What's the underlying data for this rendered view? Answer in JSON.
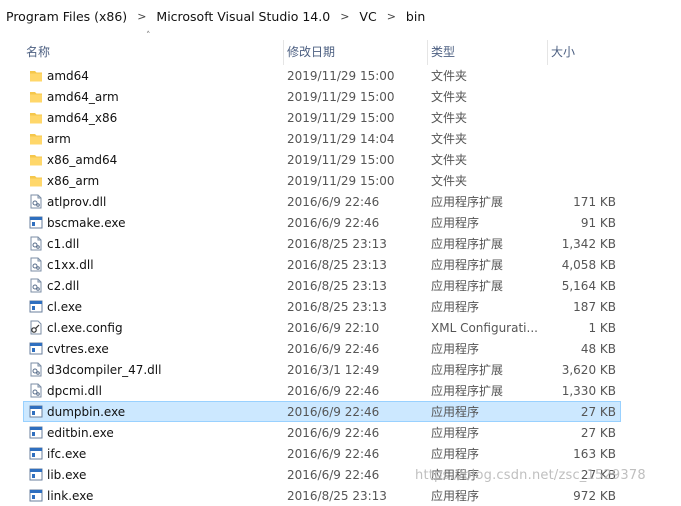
{
  "breadcrumb": [
    "Program Files (x86)",
    "Microsoft Visual Studio 14.0",
    "VC",
    "bin"
  ],
  "columns": {
    "name": "名称",
    "date": "修改日期",
    "type": "类型",
    "size": "大小"
  },
  "files": [
    {
      "name": "amd64",
      "date": "2019/11/29 15:00",
      "type": "文件夹",
      "size": "",
      "icon": "folder-icon"
    },
    {
      "name": "amd64_arm",
      "date": "2019/11/29 15:00",
      "type": "文件夹",
      "size": "",
      "icon": "folder-icon"
    },
    {
      "name": "amd64_x86",
      "date": "2019/11/29 15:00",
      "type": "文件夹",
      "size": "",
      "icon": "folder-icon"
    },
    {
      "name": "arm",
      "date": "2019/11/29 14:04",
      "type": "文件夹",
      "size": "",
      "icon": "folder-icon"
    },
    {
      "name": "x86_amd64",
      "date": "2019/11/29 15:00",
      "type": "文件夹",
      "size": "",
      "icon": "folder-icon"
    },
    {
      "name": "x86_arm",
      "date": "2019/11/29 15:00",
      "type": "文件夹",
      "size": "",
      "icon": "folder-icon"
    },
    {
      "name": "atlprov.dll",
      "date": "2016/6/9 22:46",
      "type": "应用程序扩展",
      "size": "171 KB",
      "icon": "dll-file-icon"
    },
    {
      "name": "bscmake.exe",
      "date": "2016/6/9 22:46",
      "type": "应用程序",
      "size": "91 KB",
      "icon": "exe-file-icon"
    },
    {
      "name": "c1.dll",
      "date": "2016/8/25 23:13",
      "type": "应用程序扩展",
      "size": "1,342 KB",
      "icon": "dll-file-icon"
    },
    {
      "name": "c1xx.dll",
      "date": "2016/8/25 23:13",
      "type": "应用程序扩展",
      "size": "4,058 KB",
      "icon": "dll-file-icon"
    },
    {
      "name": "c2.dll",
      "date": "2016/8/25 23:13",
      "type": "应用程序扩展",
      "size": "5,164 KB",
      "icon": "dll-file-icon"
    },
    {
      "name": "cl.exe",
      "date": "2016/8/25 23:13",
      "type": "应用程序",
      "size": "187 KB",
      "icon": "exe-file-icon"
    },
    {
      "name": "cl.exe.config",
      "date": "2016/6/9 22:10",
      "type": "XML Configurati...",
      "size": "1 KB",
      "icon": "config-file-icon"
    },
    {
      "name": "cvtres.exe",
      "date": "2016/6/9 22:46",
      "type": "应用程序",
      "size": "48 KB",
      "icon": "exe-file-icon"
    },
    {
      "name": "d3dcompiler_47.dll",
      "date": "2016/3/1 12:49",
      "type": "应用程序扩展",
      "size": "3,620 KB",
      "icon": "dll-file-icon"
    },
    {
      "name": "dpcmi.dll",
      "date": "2016/6/9 22:46",
      "type": "应用程序扩展",
      "size": "1,330 KB",
      "icon": "dll-file-icon"
    },
    {
      "name": "dumpbin.exe",
      "date": "2016/6/9 22:46",
      "type": "应用程序",
      "size": "27 KB",
      "icon": "exe-file-icon",
      "selected": true
    },
    {
      "name": "editbin.exe",
      "date": "2016/6/9 22:46",
      "type": "应用程序",
      "size": "27 KB",
      "icon": "exe-file-icon"
    },
    {
      "name": "ifc.exe",
      "date": "2016/6/9 22:46",
      "type": "应用程序",
      "size": "163 KB",
      "icon": "exe-file-icon"
    },
    {
      "name": "lib.exe",
      "date": "2016/6/9 22:46",
      "type": "应用程序",
      "size": "27 KB",
      "icon": "exe-file-icon"
    },
    {
      "name": "link.exe",
      "date": "2016/8/25 23:13",
      "type": "应用程序",
      "size": "972 KB",
      "icon": "exe-file-icon"
    }
  ],
  "watermark": "https://blog.csdn.net/zsc_1529378",
  "colors": {
    "selection_bg": "#cce8ff",
    "selection_border": "#99d1ff",
    "folder": "#f5c74c",
    "header_text": "#4d6082"
  }
}
